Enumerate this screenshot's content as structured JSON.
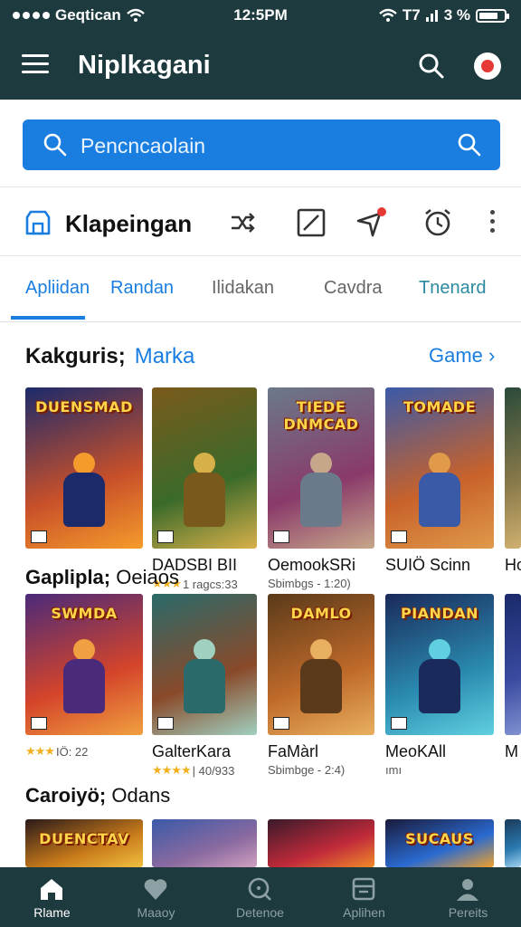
{
  "status_bar": {
    "carrier": "Geqtican",
    "time": "12:5PM",
    "network": "T7",
    "battery": "3 %",
    "battery_level": 0.75
  },
  "header": {
    "title": "Niplkagani",
    "icons": [
      "menu-icon",
      "search-icon",
      "record-icon"
    ]
  },
  "search": {
    "placeholder": "Pencncaolain"
  },
  "toolbar": {
    "title": "Klapeingan",
    "icons": [
      "storefront-icon",
      "shuffle-icon",
      "edit-icon",
      "pin-icon",
      "alarm-icon",
      "more-icon"
    ]
  },
  "tabs": [
    {
      "label": "Apliidan",
      "active": true
    },
    {
      "label": "Randan",
      "active": false
    },
    {
      "label": "Ilidakan",
      "active": false
    },
    {
      "label": "Cavdra",
      "active": false
    },
    {
      "label": "Tnenard",
      "active": false
    }
  ],
  "sections": [
    {
      "title": "Kakguris;",
      "subtitle": "Marka",
      "more": "Game ›",
      "items": [
        {
          "name": "",
          "meta": "",
          "rating": 0
        },
        {
          "name": "DADSBI BII",
          "meta": "1 ragcs:33",
          "rating": 3
        },
        {
          "name": "OemookSRi",
          "meta": "Sbimbgs - 1:20)",
          "rating": 0
        },
        {
          "name": "SUIÖ Scinn",
          "meta": "",
          "rating": 0
        },
        {
          "name": "Ho",
          "meta": "",
          "rating": 0
        }
      ]
    },
    {
      "title": "Gaplipla;",
      "subtitle": "Oeiaos",
      "items": [
        {
          "name": "",
          "meta": "IÖ: 22",
          "rating": 3
        },
        {
          "name": "GalterKara",
          "meta": "| 40/933",
          "rating": 4
        },
        {
          "name": "FaMàrl",
          "meta": "Sbimbge - 2:4)",
          "rating": 0
        },
        {
          "name": "MeoKAll",
          "meta": "ımı",
          "rating": 0
        },
        {
          "name": "M",
          "meta": "",
          "rating": 0
        }
      ]
    },
    {
      "title": "Caroiyö;",
      "subtitle": "Odans"
    }
  ],
  "cover_titles": [
    "DUENSMAD",
    "",
    "TIEDE DNMCAD",
    "TOMADE",
    "",
    "SWMDA",
    "",
    "DAMLO",
    "PIANDAN",
    "",
    "DUENCTAV",
    "",
    "",
    "SUCAUS",
    ""
  ],
  "bottom_nav": [
    {
      "label": "Rlame",
      "icon": "home-icon",
      "active": true
    },
    {
      "label": "Maaoy",
      "icon": "heart-icon",
      "active": false
    },
    {
      "label": "Detenoe",
      "icon": "discover-icon",
      "active": false
    },
    {
      "label": "Aplihen",
      "icon": "apps-icon",
      "active": false
    },
    {
      "label": "Pereits",
      "icon": "profile-icon",
      "active": false
    }
  ],
  "colors": {
    "header_bg": "#1d3a3f",
    "accent": "#1a7ee0",
    "star": "#f2b01e",
    "notification": "#e53935"
  }
}
